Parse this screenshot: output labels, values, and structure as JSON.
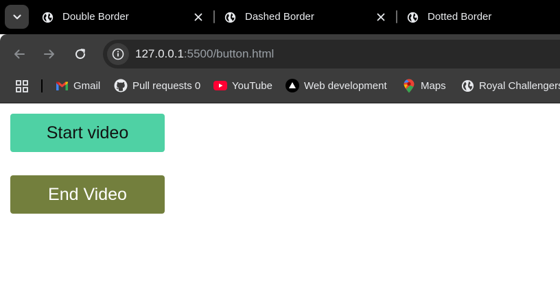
{
  "tabs": [
    {
      "title": "Double Border",
      "icon": "globe-icon"
    },
    {
      "title": "Dashed Border",
      "icon": "globe-icon"
    },
    {
      "title": "Dotted Border",
      "icon": "globe-icon"
    }
  ],
  "address_bar": {
    "host": "127.0.0.1",
    "rest": ":5500/button.html"
  },
  "bookmarks": [
    {
      "label": "Gmail",
      "icon": "gmail-icon"
    },
    {
      "label": "Pull requests 0",
      "icon": "github-icon"
    },
    {
      "label": "YouTube",
      "icon": "youtube-icon"
    },
    {
      "label": "Web development",
      "icon": "triangle-icon"
    },
    {
      "label": "Maps",
      "icon": "maps-pin-icon"
    },
    {
      "label": "Royal Challengers",
      "icon": "globe-icon"
    }
  ],
  "page": {
    "start_button": {
      "label": "Start video",
      "bg": "#4fd1a4",
      "color": "#111111"
    },
    "end_button": {
      "label": "End Video",
      "bg": "#737f3d",
      "color": "#ffffff"
    }
  },
  "colors": {
    "tabstrip": "#000000",
    "toolbar": "#3c3c3c",
    "omnibox": "#282828",
    "text": "#e8eaed"
  }
}
